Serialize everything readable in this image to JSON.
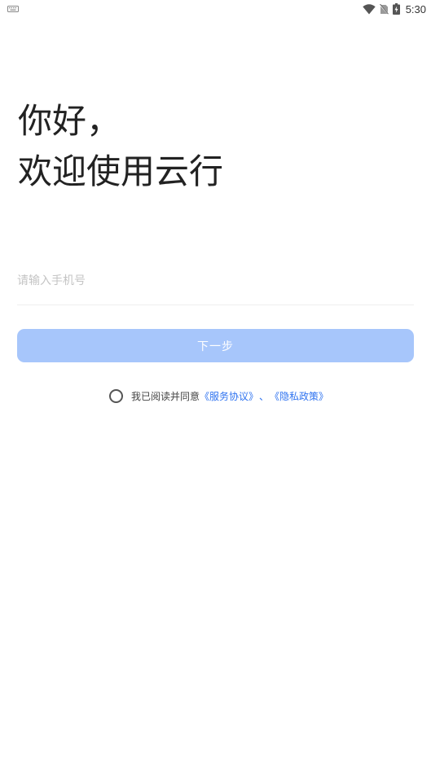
{
  "status_bar": {
    "time": "5:30",
    "icons": [
      "keyboard-icon",
      "wifi-icon",
      "no-sim-icon",
      "battery-charging-icon"
    ]
  },
  "greeting": {
    "line1": "你好，",
    "line2": "欢迎使用云行"
  },
  "phone": {
    "placeholder": "请输入手机号",
    "value": ""
  },
  "next_button": {
    "label": "下一步",
    "color": "#a7c6fb"
  },
  "agreement": {
    "prefix": "我已阅读并同意",
    "service_link": "《服务协议》",
    "separator": "、",
    "privacy_link": "《隐私政策》",
    "link_color": "#2f73f0",
    "checked": false
  }
}
